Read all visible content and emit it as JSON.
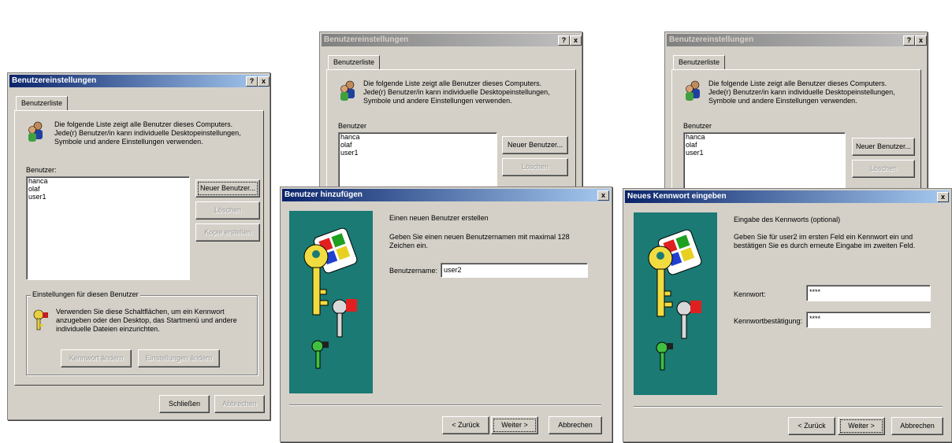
{
  "dialog1": {
    "title": "Benutzereinstellungen",
    "help_btn": "?",
    "close_btn": "x",
    "tab": "Benutzerliste",
    "intro": "Die folgende Liste zeigt alle Benutzer dieses Computers. Jede(r) Benutzer/in kann individuelle Desktopeinstellungen, Symbole und andere Einstellungen verwenden.",
    "users_label": "Benutzer:",
    "users": [
      "hanca",
      "olaf",
      "user1"
    ],
    "new_user": "Neuer Benutzer...",
    "delete": "Löschen",
    "copy": "Kopie erstellen",
    "group_label": "Einstellungen für diesen Benutzer",
    "group_text": "Verwenden Sie diese Schaltflächen, um ein Kennwort anzugeben oder den Desktop, das Startmenü und andere individuelle Dateien einzurichten.",
    "change_password": "Kennwort ändern",
    "change_settings": "Einstellungen ändern",
    "close": "Schließen",
    "cancel": "Abbrechen"
  },
  "dialog2": {
    "title": "Benutzereinstellungen",
    "help_btn": "?",
    "close_btn": "x",
    "tab": "Benutzerliste",
    "intro": "Die folgende Liste zeigt alle Benutzer dieses Computers. Jede(r) Benutzer/in kann individuelle Desktopeinstellungen, Symbole und andere Einstellungen verwenden.",
    "users_label": "Benutzer",
    "users": [
      "hanca",
      "olaf",
      "user1"
    ],
    "new_user": "Neuer Benutzer...",
    "delete": "Löschen"
  },
  "wizard1": {
    "title": "Benutzer hinzufügen",
    "close_btn": "x",
    "heading": "Einen neuen Benutzer erstellen",
    "desc": "Geben Sie einen neuen Benutzernamen mit maximal 128 Zeichen ein.",
    "username_label": "Benutzername:",
    "username_value": "user2",
    "back": "< Zurück",
    "next": "Weiter >",
    "cancel": "Abbrechen"
  },
  "dialog3": {
    "title": "Benutzereinstellungen",
    "help_btn": "?",
    "close_btn": "x",
    "tab": "Benutzerliste",
    "intro": "Die folgende Liste zeigt alle Benutzer dieses Computers. Jede(r) Benutzer/in kann individuelle Desktopeinstellungen, Symbole und andere Einstellungen verwenden.",
    "users_label": "Benutzer",
    "users": [
      "hanca",
      "olaf",
      "user1"
    ],
    "new_user": "Neuer Benutzer...",
    "delete": "Löschen"
  },
  "wizard2": {
    "title": "Neues Kennwort eingeben",
    "close_btn": "x",
    "heading": "Eingabe des Kennworts (optional)",
    "desc": "Geben Sie für user2 im ersten Feld ein Kennwort ein und bestätigen Sie es durch erneute Eingabe im zweiten Feld.",
    "password_label": "Kennwort:",
    "password_value": "****",
    "confirm_label": "Kennwortbestätigung:",
    "confirm_value": "****",
    "back": "< Zurück",
    "next": "Weiter >",
    "cancel": "Abbrechen"
  },
  "colors": {
    "titlebar_active": "#0a246a",
    "dialog_bg": "#d4d0c8",
    "wizard_panel": "#1b7a74"
  }
}
